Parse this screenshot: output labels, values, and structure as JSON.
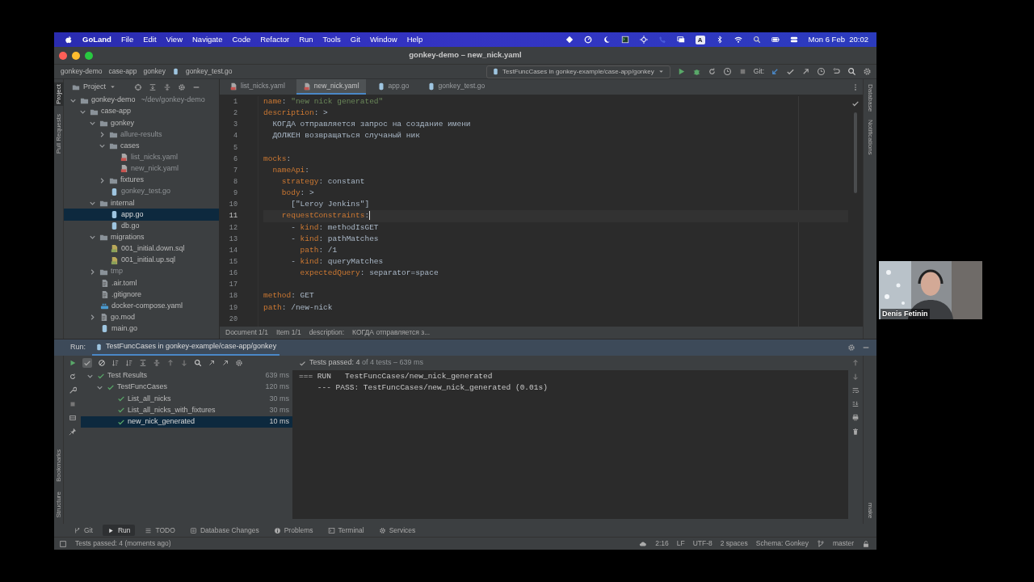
{
  "menu_bar": {
    "app": "GoLand",
    "items": [
      "File",
      "Edit",
      "View",
      "Navigate",
      "Code",
      "Refactor",
      "Run",
      "Tools",
      "Git",
      "Window",
      "Help"
    ],
    "input_source": "A",
    "clock": "Mon 6 Feb  20:02"
  },
  "window": {
    "title": "gonkey-demo – new_nick.yaml"
  },
  "breadcrumbs": [
    "gonkey-demo",
    "case-app",
    "gonkey",
    "gonkey_test.go"
  ],
  "run_config": "TestFuncCases in gonkey-example/case-app/gonkey",
  "vcs_label": "Git:",
  "left_stripe": [
    {
      "label": "Project",
      "selected": true
    },
    {
      "label": "Pull Requests",
      "selected": false
    }
  ],
  "project_panel": {
    "title": "Project",
    "tree": [
      {
        "label": "gonkey-demo",
        "note": "~/dev/gonkey-demo",
        "kind": "folder",
        "expanded": true,
        "selected": false,
        "muted": false,
        "children": [
          {
            "label": "case-app",
            "kind": "folder",
            "expanded": true,
            "selected": false,
            "muted": false,
            "children": [
              {
                "label": "gonkey",
                "kind": "folder",
                "expanded": true,
                "selected": false,
                "muted": false,
                "children": [
                  {
                    "label": "allure-results",
                    "kind": "folder",
                    "expanded": false,
                    "selected": false,
                    "muted": true
                  },
                  {
                    "label": "cases",
                    "kind": "folder",
                    "expanded": true,
                    "selected": false,
                    "muted": false,
                    "children": [
                      {
                        "label": "list_nicks.yaml",
                        "kind": "yaml",
                        "selected": false,
                        "muted": true
                      },
                      {
                        "label": "new_nick.yaml",
                        "kind": "yaml",
                        "selected": false,
                        "muted": true
                      }
                    ]
                  },
                  {
                    "label": "fixtures",
                    "kind": "folder",
                    "expanded": false,
                    "selected": false,
                    "muted": false
                  },
                  {
                    "label": "gonkey_test.go",
                    "kind": "go",
                    "selected": false,
                    "muted": true
                  }
                ]
              },
              {
                "label": "internal",
                "kind": "folder",
                "expanded": true,
                "selected": false,
                "muted": false,
                "children": [
                  {
                    "label": "app.go",
                    "kind": "go",
                    "selected": true,
                    "muted": false
                  },
                  {
                    "label": "db.go",
                    "kind": "go",
                    "selected": false,
                    "muted": false
                  }
                ]
              },
              {
                "label": "migrations",
                "kind": "folder",
                "expanded": true,
                "selected": false,
                "muted": false,
                "children": [
                  {
                    "label": "001_initial.down.sql",
                    "kind": "sql",
                    "selected": false,
                    "muted": false
                  },
                  {
                    "label": "001_initial.up.sql",
                    "kind": "sql",
                    "selected": false,
                    "muted": false
                  }
                ]
              },
              {
                "label": "tmp",
                "kind": "folder",
                "expanded": false,
                "selected": false,
                "muted": true
              },
              {
                "label": ".air.toml",
                "kind": "config",
                "selected": false,
                "muted": false
              },
              {
                "label": ".gitignore",
                "kind": "config",
                "selected": false,
                "muted": false
              },
              {
                "label": "docker-compose.yaml",
                "kind": "docker",
                "selected": false,
                "muted": false
              },
              {
                "label": "go.mod",
                "kind": "config",
                "expanded": false,
                "selected": false,
                "muted": false
              },
              {
                "label": "main.go",
                "kind": "go",
                "selected": false,
                "muted": false
              }
            ]
          }
        ]
      }
    ]
  },
  "editor": {
    "tabs": [
      {
        "label": "list_nicks.yaml",
        "kind": "yaml",
        "selected": false
      },
      {
        "label": "new_nick.yaml",
        "kind": "yaml",
        "selected": true
      },
      {
        "label": "app.go",
        "kind": "go",
        "selected": false
      },
      {
        "label": "gonkey_test.go",
        "kind": "go",
        "selected": false
      }
    ],
    "lines": [
      {
        "number": "1",
        "current": false,
        "parts": [
          {
            "kind": "key",
            "text": "name"
          },
          {
            "kind": "text",
            "text": ": "
          },
          {
            "kind": "string",
            "text": "\"new nick generated\""
          }
        ]
      },
      {
        "number": "2",
        "current": false,
        "parts": [
          {
            "kind": "key",
            "text": "description"
          },
          {
            "kind": "text",
            "text": ": >"
          }
        ]
      },
      {
        "number": "3",
        "current": false,
        "parts": [
          {
            "kind": "text",
            "text": "  КОГДА отправляется запрос на создание имени"
          }
        ]
      },
      {
        "number": "4",
        "current": false,
        "parts": [
          {
            "kind": "text",
            "text": "  ДОЛЖЕН возвращаться случаный ник"
          }
        ]
      },
      {
        "number": "5",
        "current": false
      },
      {
        "number": "6",
        "current": false,
        "parts": [
          {
            "kind": "key",
            "text": "mocks"
          },
          {
            "kind": "text",
            "text": ":"
          }
        ]
      },
      {
        "number": "7",
        "current": false,
        "parts": [
          {
            "kind": "key",
            "text": "  nameApi"
          },
          {
            "kind": "text",
            "text": ":"
          }
        ]
      },
      {
        "number": "8",
        "current": false,
        "parts": [
          {
            "kind": "key",
            "text": "    strategy"
          },
          {
            "kind": "text",
            "text": ": constant"
          }
        ]
      },
      {
        "number": "9",
        "current": false,
        "parts": [
          {
            "kind": "key",
            "text": "    body"
          },
          {
            "kind": "text",
            "text": ": >"
          }
        ]
      },
      {
        "number": "10",
        "current": false,
        "parts": [
          {
            "kind": "text",
            "text": "      [\"Leroy Jenkins\"]"
          }
        ]
      },
      {
        "number": "11",
        "current": true,
        "parts": [
          {
            "kind": "key",
            "text": "    requestConstraints"
          },
          {
            "kind": "text",
            "text": ":"
          }
        ]
      },
      {
        "number": "12",
        "current": false,
        "parts": [
          {
            "kind": "text",
            "text": "      - "
          },
          {
            "kind": "key",
            "text": "kind"
          },
          {
            "kind": "text",
            "text": ": methodIsGET"
          }
        ]
      },
      {
        "number": "13",
        "current": false,
        "parts": [
          {
            "kind": "text",
            "text": "      - "
          },
          {
            "kind": "key",
            "text": "kind"
          },
          {
            "kind": "text",
            "text": ": pathMatches"
          }
        ]
      },
      {
        "number": "14",
        "current": false,
        "parts": [
          {
            "kind": "key",
            "text": "        path"
          },
          {
            "kind": "text",
            "text": ": /1"
          }
        ]
      },
      {
        "number": "15",
        "current": false,
        "parts": [
          {
            "kind": "text",
            "text": "      - "
          },
          {
            "kind": "key",
            "text": "kind"
          },
          {
            "kind": "text",
            "text": ": queryMatches"
          }
        ]
      },
      {
        "number": "16",
        "current": false,
        "parts": [
          {
            "kind": "key",
            "text": "        expectedQuery"
          },
          {
            "kind": "text",
            "text": ": separator=space"
          }
        ]
      },
      {
        "number": "17",
        "current": false
      },
      {
        "number": "18",
        "current": false,
        "parts": [
          {
            "kind": "key",
            "text": "method"
          },
          {
            "kind": "text",
            "text": ": GET"
          }
        ]
      },
      {
        "number": "19",
        "current": false,
        "parts": [
          {
            "kind": "key",
            "text": "path"
          },
          {
            "kind": "text",
            "text": ": /new-nick"
          }
        ]
      },
      {
        "number": "20",
        "current": false
      }
    ],
    "breadcrumbs": [
      "Document 1/1",
      "Item 1/1",
      "description:",
      "КОГДА отправляется з..."
    ]
  },
  "right_stripe": [
    "Database",
    "Notifications"
  ],
  "run_panel": {
    "label": "Run:",
    "tab": "TestFuncCases in gonkey-example/case-app/gonkey",
    "summary": "Tests passed: 4",
    "summary_detail": "of 4 tests – 639 ms",
    "tests": [
      {
        "label": "Test Results",
        "time": "639 ms",
        "expanded": true,
        "selected": false,
        "children": [
          {
            "label": "TestFuncCases",
            "time": "120 ms",
            "expanded": true,
            "selected": false,
            "children": [
              {
                "label": "List_all_nicks",
                "time": "30 ms",
                "selected": false
              },
              {
                "label": "List_all_nicks_with_fixtures",
                "time": "30 ms",
                "selected": false
              },
              {
                "label": "new_nick_generated",
                "time": "10 ms",
                "selected": true
              }
            ]
          }
        ]
      }
    ],
    "console": [
      "=== RUN   TestFuncCases/new_nick_generated",
      "    --- PASS: TestFuncCases/new_nick_generated (0.01s)"
    ]
  },
  "bottom_left_stripe": [
    "Bookmarks",
    "Structure"
  ],
  "bottom_right_stripe": [
    "make"
  ],
  "tool_tabs": [
    {
      "label": "Git",
      "selected": false
    },
    {
      "label": "Run",
      "selected": true
    },
    {
      "label": "TODO",
      "selected": false
    },
    {
      "label": "Database Changes",
      "selected": false
    },
    {
      "label": "Problems",
      "selected": false
    },
    {
      "label": "Terminal",
      "selected": false
    },
    {
      "label": "Services",
      "selected": false
    }
  ],
  "status_bar": {
    "message": "Tests passed: 4 (moments ago)",
    "items": [
      "2:16",
      "LF",
      "UTF-8",
      "2 spaces",
      "Schema: Gonkey",
      "master"
    ]
  },
  "camera": {
    "name": "Denis Fetinin"
  }
}
